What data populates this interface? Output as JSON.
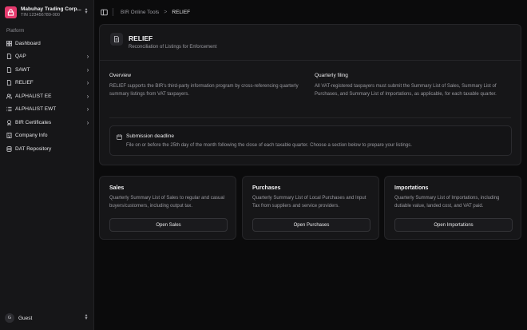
{
  "org": {
    "name": "Mabuhay Trading Corp...",
    "tin": "TIN 123456789-000"
  },
  "sidebar": {
    "section_label": "Platform",
    "items": [
      {
        "label": "Dashboard",
        "icon": "dashboard-icon",
        "chevron": false
      },
      {
        "label": "QAP",
        "icon": "document-icon",
        "chevron": true
      },
      {
        "label": "SAWT",
        "icon": "document-icon",
        "chevron": true
      },
      {
        "label": "RELIEF",
        "icon": "document-icon",
        "chevron": true
      },
      {
        "label": "ALPHALIST EE",
        "icon": "users-icon",
        "chevron": true
      },
      {
        "label": "ALPHALIST EWT",
        "icon": "list-icon",
        "chevron": true
      },
      {
        "label": "BIR Certificates",
        "icon": "certificate-icon",
        "chevron": true
      },
      {
        "label": "Company Info",
        "icon": "building-icon",
        "chevron": false
      },
      {
        "label": "DAT Repository",
        "icon": "database-icon",
        "chevron": false
      }
    ]
  },
  "user": {
    "initial": "G",
    "name": "Guest"
  },
  "breadcrumb": {
    "parent": "BIR Online Tools",
    "separator": ">",
    "current": "RELIEF"
  },
  "panel": {
    "title": "RELIEF",
    "subtitle": "Reconciliation of Listings for Enforcement",
    "overview_title": "Overview",
    "overview_text": "RELIEF supports the BIR's third-party information program by cross-referencing quarterly summary listings from VAT taxpayers.",
    "quarterly_title": "Quarterly filing",
    "quarterly_text": "All VAT-registered taxpayers must submit the Summary List of Sales, Summary List of Purchases, and Summary List of Importations, as applicable, for each taxable quarter.",
    "deadline_title": "Submission deadline",
    "deadline_text": "File on or before the 25th day of the month following the close of each taxable quarter. Choose a section below to prepare your listings."
  },
  "cards": [
    {
      "title": "Sales",
      "text": "Quarterly Summary List of Sales to regular and casual buyers/customers, including output tax.",
      "button": "Open Sales"
    },
    {
      "title": "Purchases",
      "text": "Quarterly Summary List of Local Purchases and Input Tax from suppliers and service providers.",
      "button": "Open Purchases"
    },
    {
      "title": "Importations",
      "text": "Quarterly Summary List of Importations, including dutiable value, landed cost, and VAT paid.",
      "button": "Open Importations"
    }
  ],
  "colors": {
    "accent": "#e53a6e",
    "background": "#0b0b0c",
    "panel": "#161618"
  }
}
